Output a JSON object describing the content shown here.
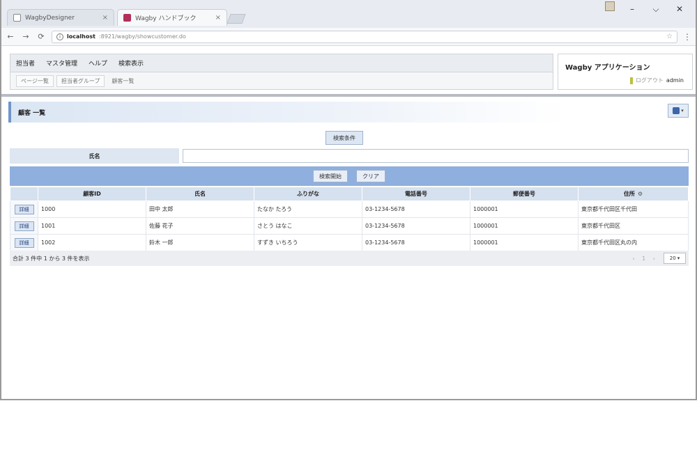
{
  "browser": {
    "tabs": [
      {
        "title": "WagbyDesigner",
        "close": "×"
      },
      {
        "title": "Wagby ハンドブック",
        "close": "×"
      }
    ],
    "window_controls": {
      "minimize": "–",
      "maximize": "⌵",
      "close": "✕"
    },
    "nav": {
      "back": "←",
      "forward": "→",
      "reload": "⟳"
    },
    "address": {
      "host": "localhost",
      "path": ":8921/wagby/showcustomer.do"
    },
    "menu_glyph": "⋮",
    "info_glyph": "i",
    "star_glyph": "☆"
  },
  "app": {
    "menu": [
      "担当者",
      "マスタ管理",
      "ヘルプ",
      "検索表示"
    ],
    "submenu": [
      "ページ一覧",
      "担当者グループ",
      "顧客一覧"
    ],
    "title": "Wagby アプリケーション",
    "user": {
      "logout": "ログアウト",
      "role": "admin"
    }
  },
  "panel": {
    "title": "顧客 一覧",
    "tool_caret": "▾",
    "condition_button": "検索条件",
    "search_label": "氏名",
    "search_value": "",
    "buttons": {
      "search": "検索開始",
      "clear": "クリア"
    }
  },
  "table": {
    "headers": [
      "顧客ID",
      "氏名",
      "ふりがな",
      "電話番号",
      "郵便番号",
      "住所"
    ],
    "header_extra": "⚙",
    "rows": [
      {
        "action": "詳細",
        "cells": [
          "1000",
          "田中 太郎",
          "たなか たろう",
          "03-1234-5678",
          "1000001",
          "東京都千代田区千代田"
        ]
      },
      {
        "action": "詳細",
        "cells": [
          "1001",
          "佐藤 花子",
          "さとう はなこ",
          "03-1234-5678",
          "1000001",
          "東京都千代田区"
        ]
      },
      {
        "action": "詳細",
        "cells": [
          "1002",
          "鈴木 一郎",
          "すずき いちろう",
          "03-1234-5678",
          "1000001",
          "東京都千代田区丸の内"
        ]
      }
    ]
  },
  "pager": {
    "info": "合計 3 件中 1 から 3 件を表示",
    "nav": "‹ 1 ›",
    "page_size": "20",
    "page_size_caret": "▾"
  }
}
